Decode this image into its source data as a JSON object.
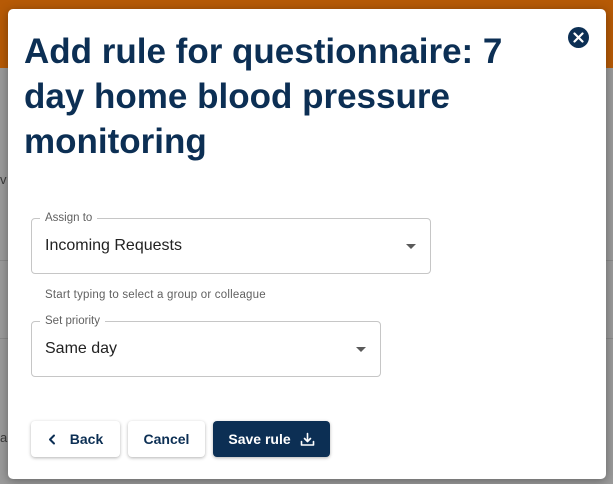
{
  "dialog": {
    "title": "Add rule for questionnaire: 7 day home blood pressure monitoring",
    "close_label": "close"
  },
  "assign_field": {
    "legend": "Assign to",
    "value": "Incoming Requests",
    "helper": "Start typing to select a group or colleague"
  },
  "priority_field": {
    "legend": "Set priority",
    "value": "Same day"
  },
  "actions": {
    "back_label": "Back",
    "cancel_label": "Cancel",
    "save_label": "Save rule"
  },
  "background": {
    "left_glyphs": [
      "v",
      "a"
    ]
  },
  "colors": {
    "primary": "#0c2f54",
    "topbar": "#b65a06",
    "field_border": "#c6c6c6",
    "helper_text": "#616161"
  },
  "icons": {
    "close": "close-circle-icon",
    "back": "chevron-left-icon",
    "save": "download-icon",
    "dropdown": "caret-down-icon"
  }
}
